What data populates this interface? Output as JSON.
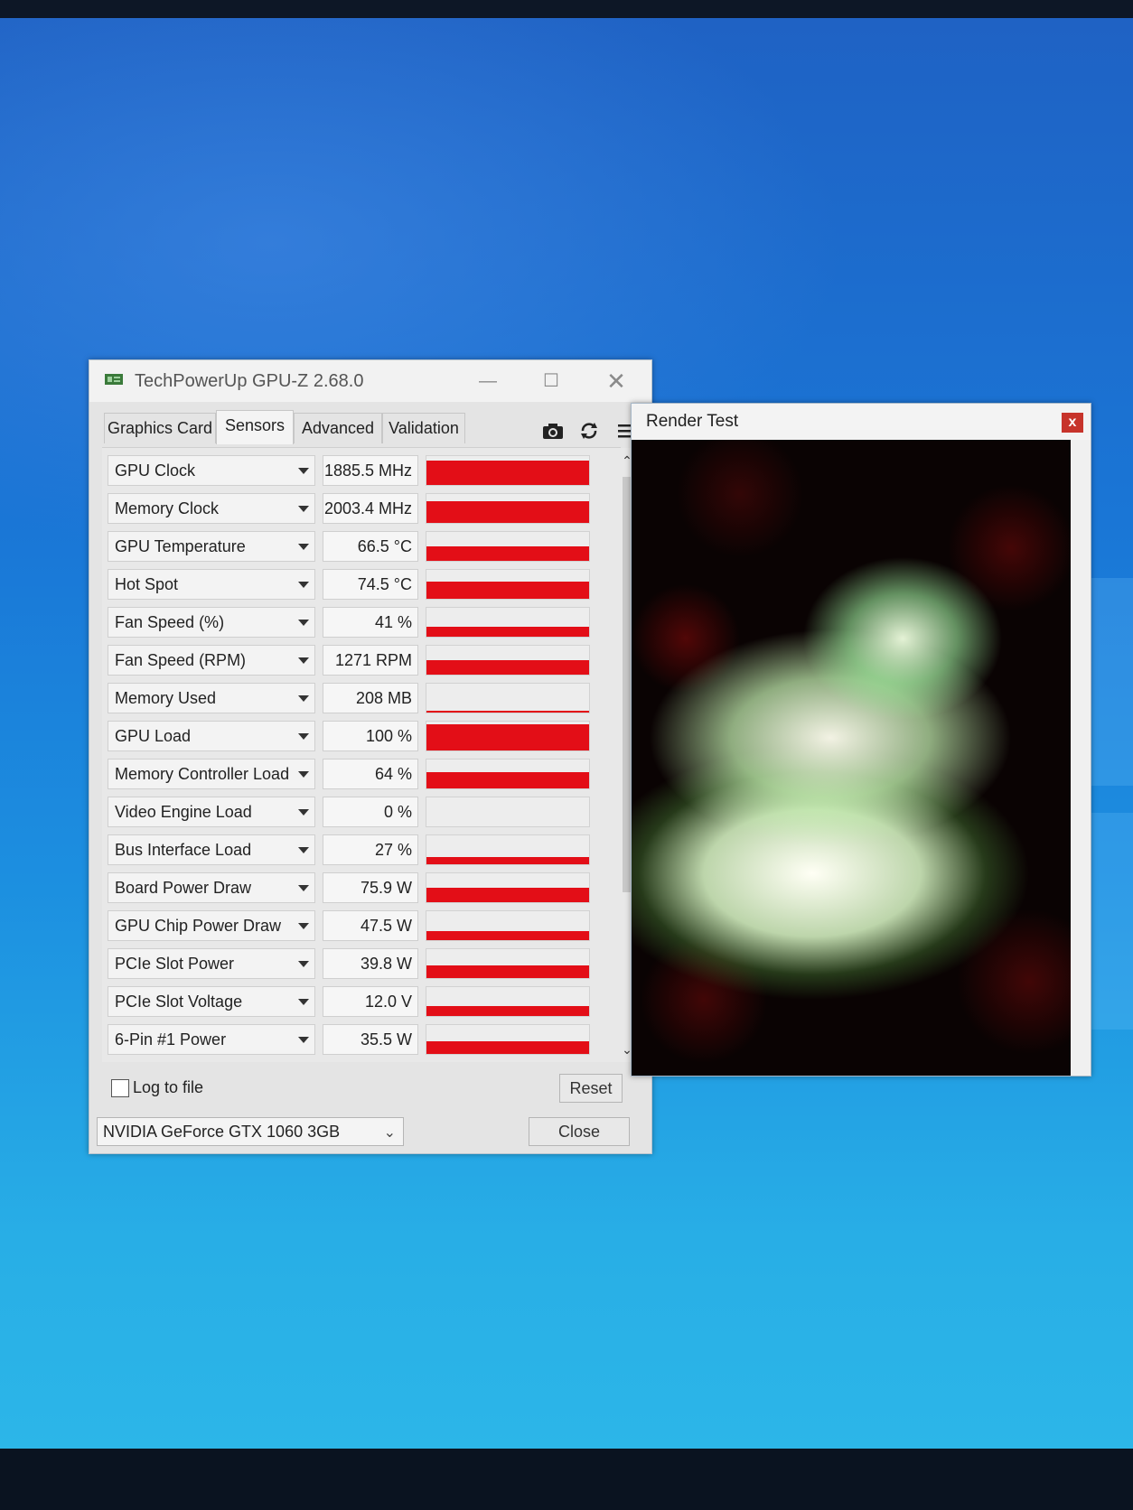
{
  "gpuz": {
    "title": "TechPowerUp GPU-Z 2.68.0",
    "tabs": [
      {
        "label": "Graphics Card",
        "active": false
      },
      {
        "label": "Sensors",
        "active": true
      },
      {
        "label": "Advanced",
        "active": false
      },
      {
        "label": "Validation",
        "active": false
      }
    ],
    "toolbar_icons": [
      "camera-icon",
      "refresh-icon",
      "menu-icon"
    ],
    "sensors": [
      {
        "label": "GPU Clock",
        "value": "1885.5 MHz",
        "level": 0.85
      },
      {
        "label": "Memory Clock",
        "value": "2003.4 MHz",
        "level": 0.75
      },
      {
        "label": "GPU Temperature",
        "value": "66.5 °C",
        "level": 0.5
      },
      {
        "label": "Hot Spot",
        "value": "74.5 °C",
        "level": 0.6
      },
      {
        "label": "Fan Speed (%)",
        "value": "41 %",
        "level": 0.35
      },
      {
        "label": "Fan Speed (RPM)",
        "value": "1271 RPM",
        "level": 0.5
      },
      {
        "label": "Memory Used",
        "value": "208 MB",
        "level": 0.05
      },
      {
        "label": "GPU Load",
        "value": "100 %",
        "level": 0.9
      },
      {
        "label": "Memory Controller Load",
        "value": "64 %",
        "level": 0.55
      },
      {
        "label": "Video Engine Load",
        "value": "0 %",
        "level": 0.0
      },
      {
        "label": "Bus Interface Load",
        "value": "27 %",
        "level": 0.25
      },
      {
        "label": "Board Power Draw",
        "value": "75.9 W",
        "level": 0.5
      },
      {
        "label": "GPU Chip Power Draw",
        "value": "47.5 W",
        "level": 0.3
      },
      {
        "label": "PCIe Slot Power",
        "value": "39.8 W",
        "level": 0.45
      },
      {
        "label": "PCIe Slot Voltage",
        "value": "12.0 V",
        "level": 0.35
      },
      {
        "label": "6-Pin #1 Power",
        "value": "35.5 W",
        "level": 0.45
      }
    ],
    "log_to_file": {
      "label": "Log to file",
      "checked": false
    },
    "reset_label": "Reset",
    "close_label": "Close",
    "gpu_select": "NVIDIA GeForce GTX 1060 3GB"
  },
  "render_test": {
    "title": "Render Test",
    "close_label": "x"
  },
  "colors": {
    "sensor_bar": "#e30e17",
    "desktop": "#1a76d6",
    "render_close": "#c7342b"
  }
}
